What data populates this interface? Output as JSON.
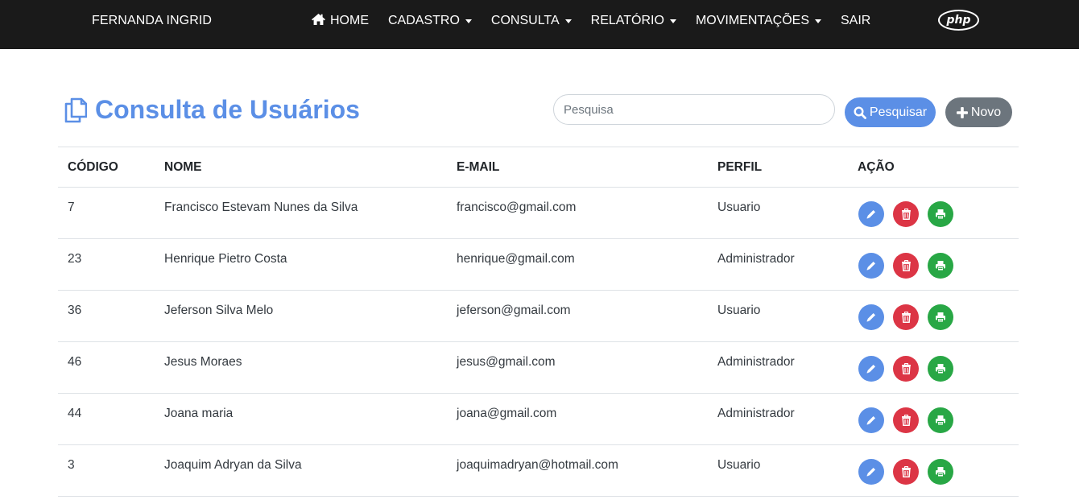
{
  "navbar": {
    "brand": "FERNANDA INGRID",
    "items": [
      {
        "label": "HOME",
        "icon": "home-icon",
        "dropdown": false
      },
      {
        "label": "CADASTRO",
        "dropdown": true
      },
      {
        "label": "CONSULTA",
        "dropdown": true
      },
      {
        "label": "RELATÓRIO",
        "dropdown": true
      },
      {
        "label": "MOVIMENTAÇÕES",
        "dropdown": true
      },
      {
        "label": "SAIR",
        "dropdown": false
      }
    ],
    "logo": "php",
    "background": "#1a1a1a"
  },
  "page": {
    "title": "Consulta de Usuários",
    "title_icon": "copy-icon",
    "accent": "#5b8fe6"
  },
  "search": {
    "placeholder": "Pesquisa",
    "value": "",
    "search_label": "Pesquisar",
    "new_label": "Novo"
  },
  "table": {
    "headers": {
      "code": "CÓDIGO",
      "name": "NOME",
      "email": "E-MAIL",
      "profile": "PERFIL",
      "action": "AÇÃO"
    },
    "rows": [
      {
        "code": "7",
        "name": "Francisco Estevam Nunes da Silva",
        "email": "francisco@gmail.com",
        "profile": "Usuario"
      },
      {
        "code": "23",
        "name": "Henrique Pietro Costa",
        "email": "henrique@gmail.com",
        "profile": "Administrador"
      },
      {
        "code": "36",
        "name": "Jeferson Silva Melo",
        "email": "jeferson@gmail.com",
        "profile": "Usuario"
      },
      {
        "code": "46",
        "name": "Jesus Moraes",
        "email": "jesus@gmail.com",
        "profile": "Administrador"
      },
      {
        "code": "44",
        "name": "Joana maria",
        "email": "joana@gmail.com",
        "profile": "Administrador"
      },
      {
        "code": "3",
        "name": "Joaquim Adryan da Silva",
        "email": "joaquimadryan@hotmail.com",
        "profile": "Usuario"
      }
    ],
    "action_icons": [
      "pencil-icon",
      "trash-icon",
      "print-icon"
    ],
    "action_colors": {
      "edit": "#5b8fe6",
      "delete": "#dc3545",
      "print": "#28a745"
    }
  }
}
